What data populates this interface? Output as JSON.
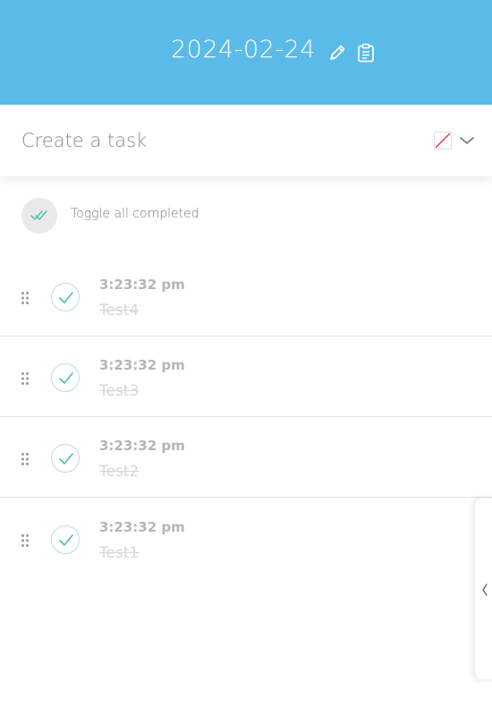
{
  "header": {
    "date": "2024-02-24",
    "background_color": "#5bbbe8",
    "edit_icon": "pencil-icon",
    "clipboard_icon": "clipboard-icon"
  },
  "create_task": {
    "placeholder": "Create a task",
    "value": "",
    "color_swatch_icon": "no-color-swatch-icon",
    "dropdown_icon": "chevron-down-icon"
  },
  "toggle_all": {
    "label": "Toggle all completed",
    "icon": "double-check-icon"
  },
  "tasks": [
    {
      "time": "3:23:32 pm",
      "title": "Test4",
      "completed": true
    },
    {
      "time": "3:23:32 pm",
      "title": "Test3",
      "completed": true
    },
    {
      "time": "3:23:32 pm",
      "title": "Test2",
      "completed": true
    },
    {
      "time": "3:23:32 pm",
      "title": "Test1",
      "completed": true
    }
  ],
  "side_panel": {
    "icon": "chevron-left-icon"
  },
  "colors": {
    "accent": "#5bbbe8",
    "check": "#4fbfa5"
  }
}
